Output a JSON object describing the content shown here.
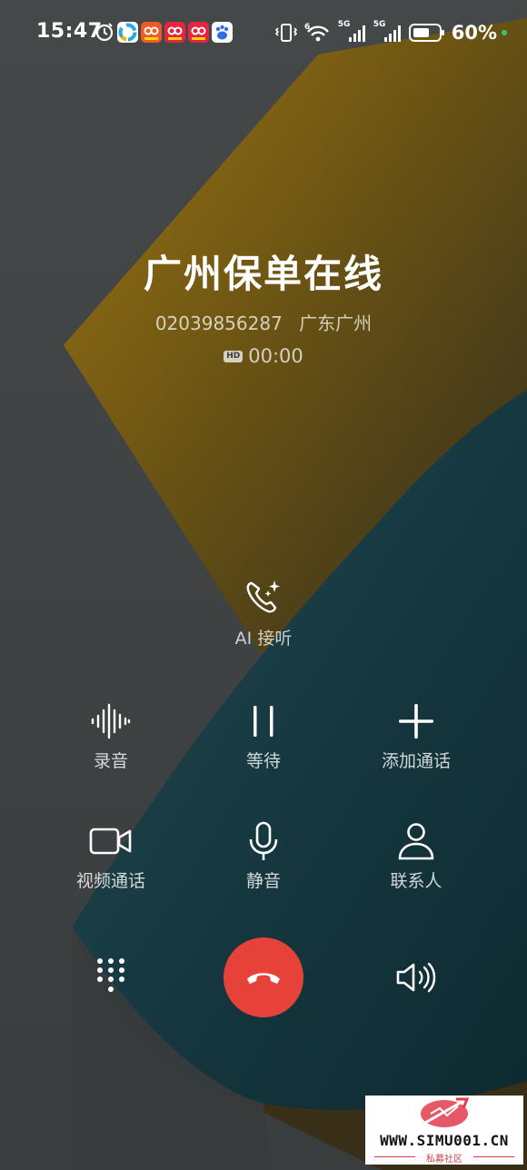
{
  "status_bar": {
    "time": "15:47",
    "battery_percent": "60%",
    "signal_1_label": "5G",
    "signal_2_label": "5G",
    "wifi_label": "6"
  },
  "caller": {
    "name": "广州保单在线",
    "number": "02039856287",
    "location": "广东广州",
    "hd_badge": "HD",
    "duration": "00:00"
  },
  "ai_answer": {
    "label": "AI 接听"
  },
  "controls": [
    {
      "label": "录音",
      "icon": "waveform-icon"
    },
    {
      "label": "等待",
      "icon": "pause-icon"
    },
    {
      "label": "添加通话",
      "icon": "plus-icon"
    },
    {
      "label": "视频通话",
      "icon": "video-camera-icon"
    },
    {
      "label": "静音",
      "icon": "microphone-icon"
    },
    {
      "label": "联系人",
      "icon": "person-icon"
    }
  ],
  "bottom": {
    "dialpad_icon": "dialpad-icon",
    "end_call_icon": "hang-up-icon",
    "speaker_icon": "speaker-icon"
  },
  "watermark": {
    "site": "WWW.SIMU001.CN",
    "subtitle": "私募社区"
  },
  "colors": {
    "end_call": "#e74239",
    "background": "#3c3f40",
    "accent_gold": "#8a6a12",
    "accent_teal": "#1d3f47"
  }
}
